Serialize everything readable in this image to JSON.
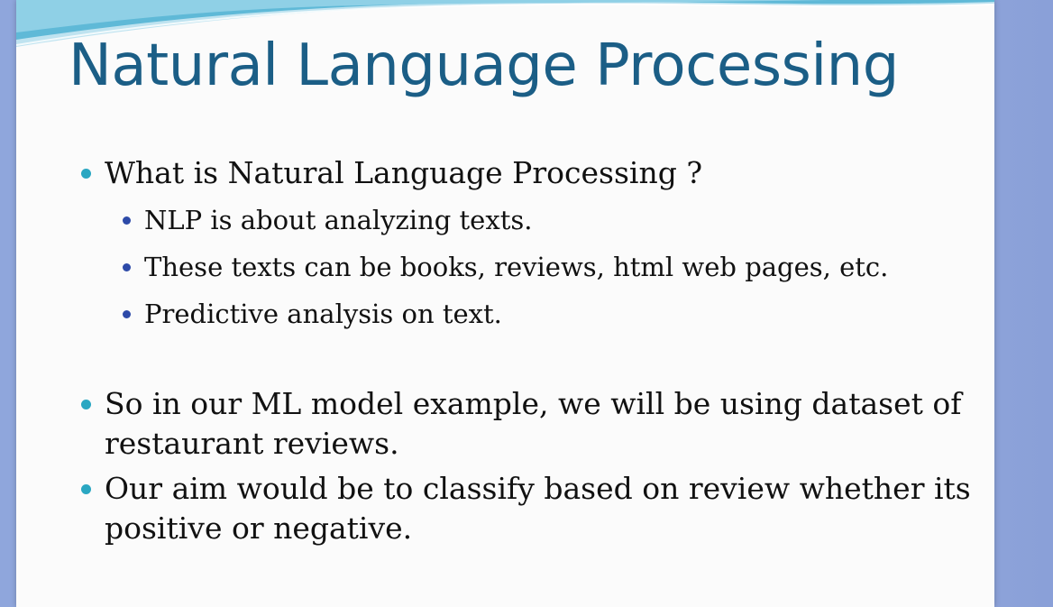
{
  "slide": {
    "title": "Natural Language Processing",
    "bullets": [
      {
        "text": "What is Natural Language Processing ?",
        "sub": [
          "NLP is about analyzing texts.",
          "These texts can be books, reviews, html web pages, etc.",
          "Predictive analysis on text."
        ]
      },
      {
        "text": "So in our ML model example, we will be using dataset of  restaurant reviews."
      },
      {
        "text": "Our aim would be to classify based on review whether its positive or negative."
      }
    ]
  },
  "colors": {
    "title": "#1b5e86",
    "bullet_level1": "#2aa7c2",
    "bullet_level2": "#2d4aa8",
    "background": "#9db2e3"
  }
}
